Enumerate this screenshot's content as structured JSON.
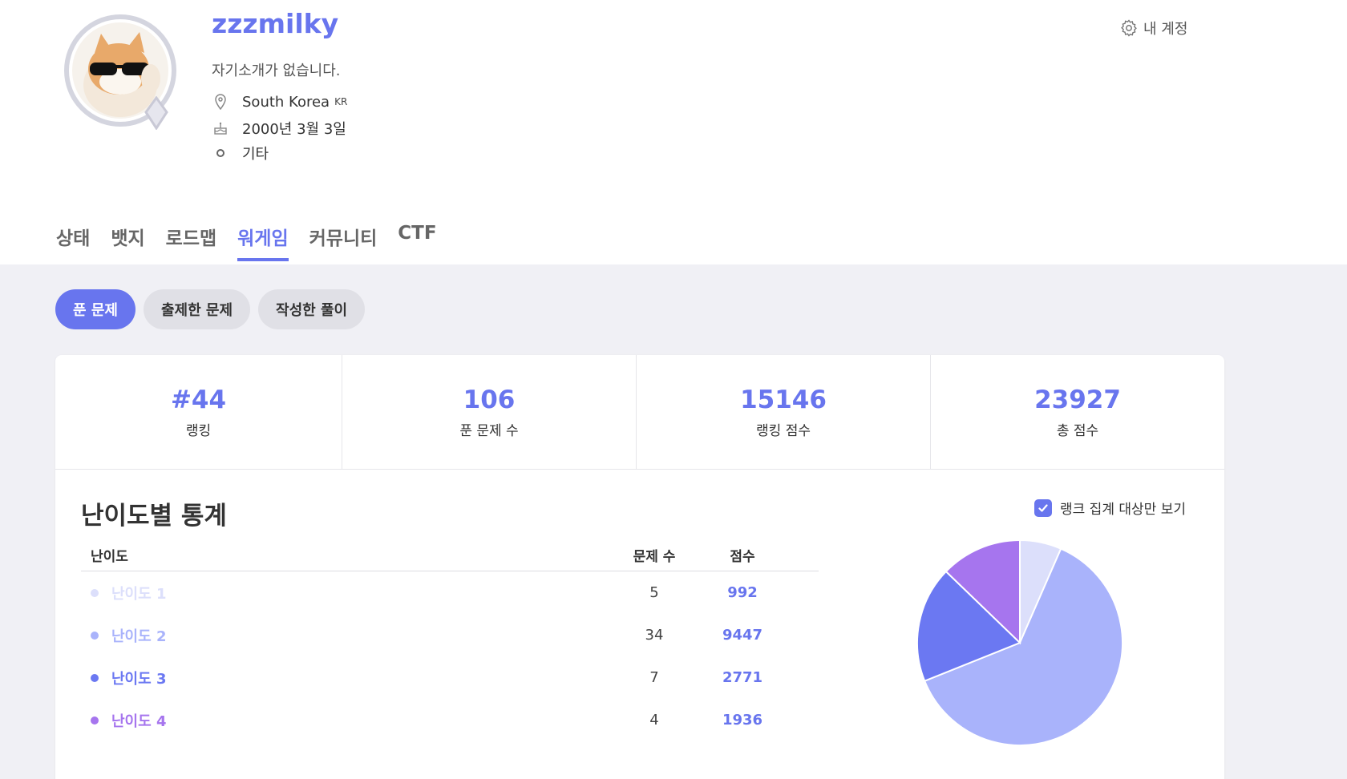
{
  "profile": {
    "username": "zzzmilky",
    "bio": "자기소개가 없습니다.",
    "country": "South Korea",
    "country_code": "KR",
    "birthday": "2000년 3월 3일",
    "gender": "기타"
  },
  "account_link": "내 계정",
  "tabs": [
    "상태",
    "뱃지",
    "로드맵",
    "워게임",
    "커뮤니티",
    "CTF"
  ],
  "active_tab": "워게임",
  "filters": [
    "푼 문제",
    "출제한 문제",
    "작성한 풀이"
  ],
  "active_filter": "푼 문제",
  "stats": [
    {
      "value": "#44",
      "label": "랭킹"
    },
    {
      "value": "106",
      "label": "푼 문제 수"
    },
    {
      "value": "15146",
      "label": "랭킹 점수"
    },
    {
      "value": "23927",
      "label": "총 점수"
    }
  ],
  "difficulty": {
    "title": "난이도별 통계",
    "rank_only_label": "랭크 집계 대상만 보기",
    "rank_only_checked": true,
    "headers": {
      "level": "난이도",
      "count": "문제 수",
      "score": "점수"
    },
    "rows": [
      {
        "level": "난이도 1",
        "count": "5",
        "score": "992",
        "color": "#dcdffb"
      },
      {
        "level": "난이도 2",
        "count": "34",
        "score": "9447",
        "color": "#a9b3fb"
      },
      {
        "level": "난이도 3",
        "count": "7",
        "score": "2771",
        "color": "#6b78f2"
      },
      {
        "level": "난이도 4",
        "count": "4",
        "score": "1936",
        "color": "#a675ee"
      }
    ]
  },
  "chart_data": {
    "type": "pie",
    "categories": [
      "난이도 1",
      "난이도 2",
      "난이도 3",
      "난이도 4"
    ],
    "values": [
      992,
      9447,
      2771,
      1936
    ],
    "colors": [
      "#dcdffb",
      "#a9b3fb",
      "#6b78f2",
      "#a675ee"
    ],
    "title": ""
  },
  "colors": {
    "accent": "#6875ee"
  }
}
